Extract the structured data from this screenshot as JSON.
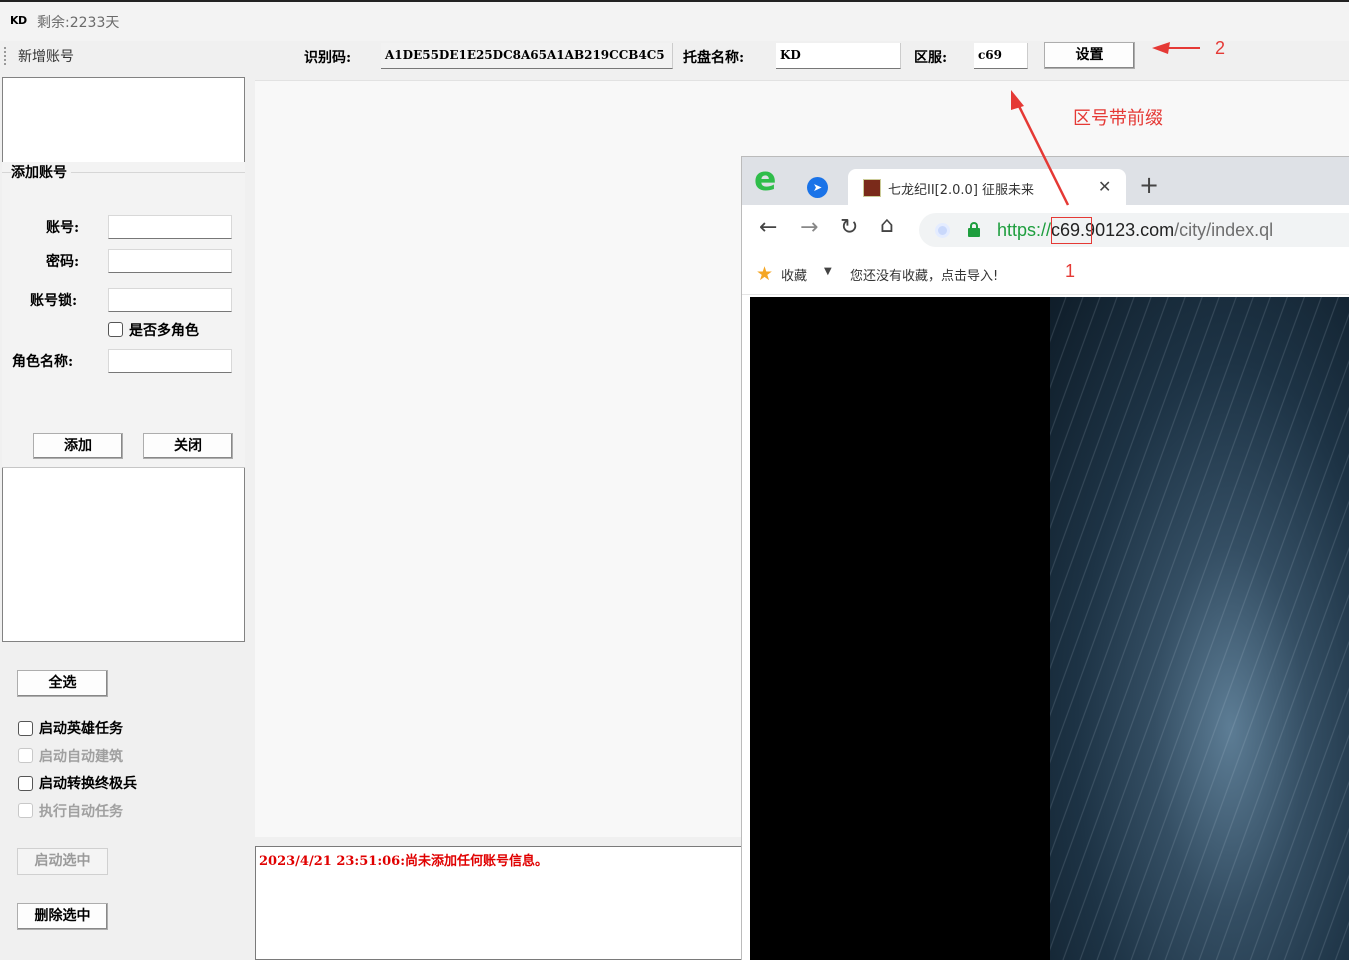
{
  "title_bar": {
    "logo": "KD",
    "remaining": "剩余:2233天"
  },
  "toolbar": {
    "new_account": "新增账号",
    "id_label": "识别码:",
    "id_value": "A1DE55DE1E25DC8A65A1AB219CCB4C5",
    "tray_label": "托盘名称:",
    "tray_value": "KD",
    "zone_label": "区服:",
    "zone_value": "c69",
    "settings_button": "设置"
  },
  "add_account": {
    "group_title": "添加账号",
    "account_label": "账号:",
    "password_label": "密码:",
    "lock_label": "账号锁:",
    "multi_role_label": "是否多角色",
    "role_name_label": "角色名称:",
    "add_button": "添加",
    "close_button": "关闭"
  },
  "actions": {
    "select_all": "全选",
    "options": [
      {
        "label": "启动英雄任务",
        "enabled": true
      },
      {
        "label": "启动自动建筑",
        "enabled": false
      },
      {
        "label": "启动转换终极兵",
        "enabled": true
      },
      {
        "label": "执行自动任务",
        "enabled": false
      }
    ],
    "start_selected": "启动选中",
    "delete_selected": "删除选中"
  },
  "log": {
    "message": "2023/4/21 23:51:06:尚未添加任何账号信息。"
  },
  "browser": {
    "tab_title": "七龙纪II[2.0.0] 征服未来",
    "url_protocol": "https://",
    "url_host": "c69.90123.com",
    "url_path": "/city/index.ql",
    "bookmark_label": "收藏",
    "bookmark_hint": "您还没有收藏，点击导入!"
  },
  "annotations": {
    "marker_1": "1",
    "marker_2": "2",
    "note": "区号带前缀",
    "color": "#e53935"
  }
}
